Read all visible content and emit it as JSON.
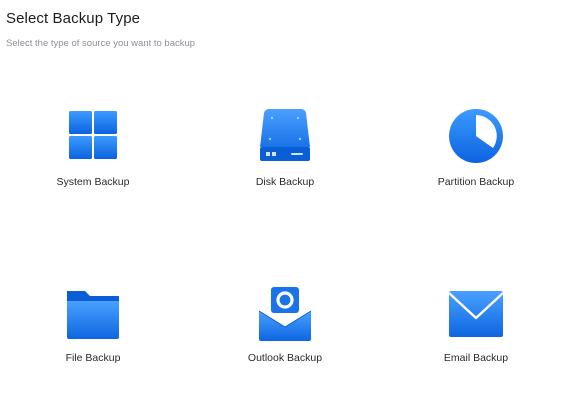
{
  "header": {
    "title": "Select Backup Type",
    "subtitle": "Select the type of source you want to backup"
  },
  "options": [
    {
      "label": "System Backup",
      "icon": "windows-icon"
    },
    {
      "label": "Disk Backup",
      "icon": "disk-icon"
    },
    {
      "label": "Partition Backup",
      "icon": "partition-pie-icon"
    },
    {
      "label": "File Backup",
      "icon": "folder-icon"
    },
    {
      "label": "Outlook Backup",
      "icon": "outlook-icon"
    },
    {
      "label": "Email Backup",
      "icon": "envelope-icon"
    }
  ],
  "colors": {
    "accent": "#1a73e8",
    "accent_light": "#4aa0ff",
    "background": "#ffffff"
  }
}
